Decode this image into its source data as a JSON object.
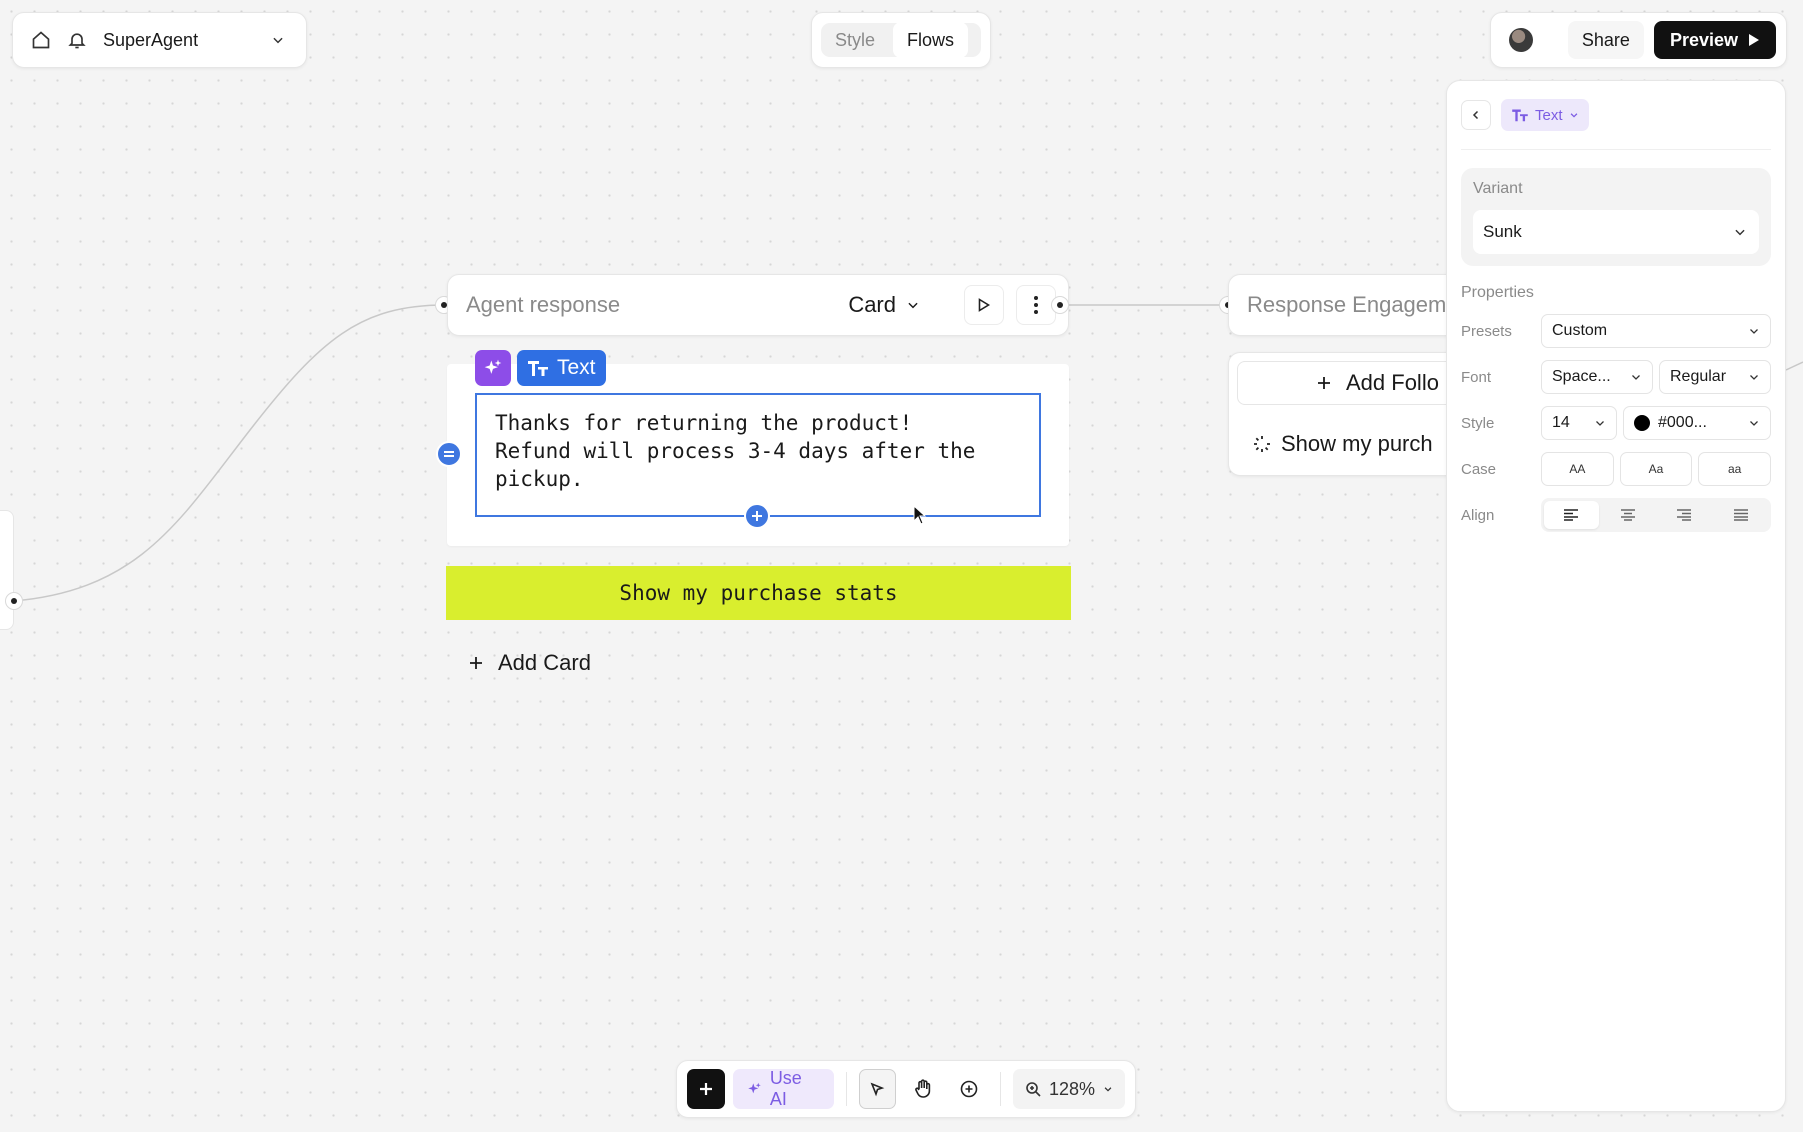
{
  "header": {
    "app_name": "SuperAgent",
    "tabs": [
      "Style",
      "Flows"
    ],
    "active_tab": "Flows",
    "share_label": "Share",
    "preview_label": "Preview"
  },
  "node": {
    "title": "Agent response",
    "type_label": "Card",
    "text_chip_label": "Text",
    "text_content_line1": "Thanks for returning the product!",
    "text_content_line2": "Refund will process 3-4 days after the",
    "text_content_line3": "pickup.",
    "cta_label": "Show my purchase stats",
    "add_card_label": "Add Card"
  },
  "node2": {
    "title": "Response Engagem",
    "add_label": "Add Follo",
    "item_label": "Show my purch"
  },
  "sidepanel": {
    "type_chip_label": "Text",
    "variant_label": "Variant",
    "variant_value": "Sunk",
    "properties_label": "Properties",
    "rows": {
      "presets_label": "Presets",
      "presets_value": "Custom",
      "font_label": "Font",
      "font_family_value": "Space...",
      "font_weight_value": "Regular",
      "style_label": "Style",
      "size_value": "14",
      "color_value": "#000...",
      "case_label": "Case",
      "case_options": [
        "AA",
        "Aa",
        "aa"
      ],
      "align_label": "Align",
      "align_active": "left"
    }
  },
  "toolbar": {
    "use_ai_label": "Use AI",
    "zoom_value": "128%"
  },
  "colors": {
    "accent_purple": "#8d4de8",
    "accent_blue": "#2f6fe3",
    "cta_lime": "#d9ee2e",
    "preview_black": "#111111"
  }
}
